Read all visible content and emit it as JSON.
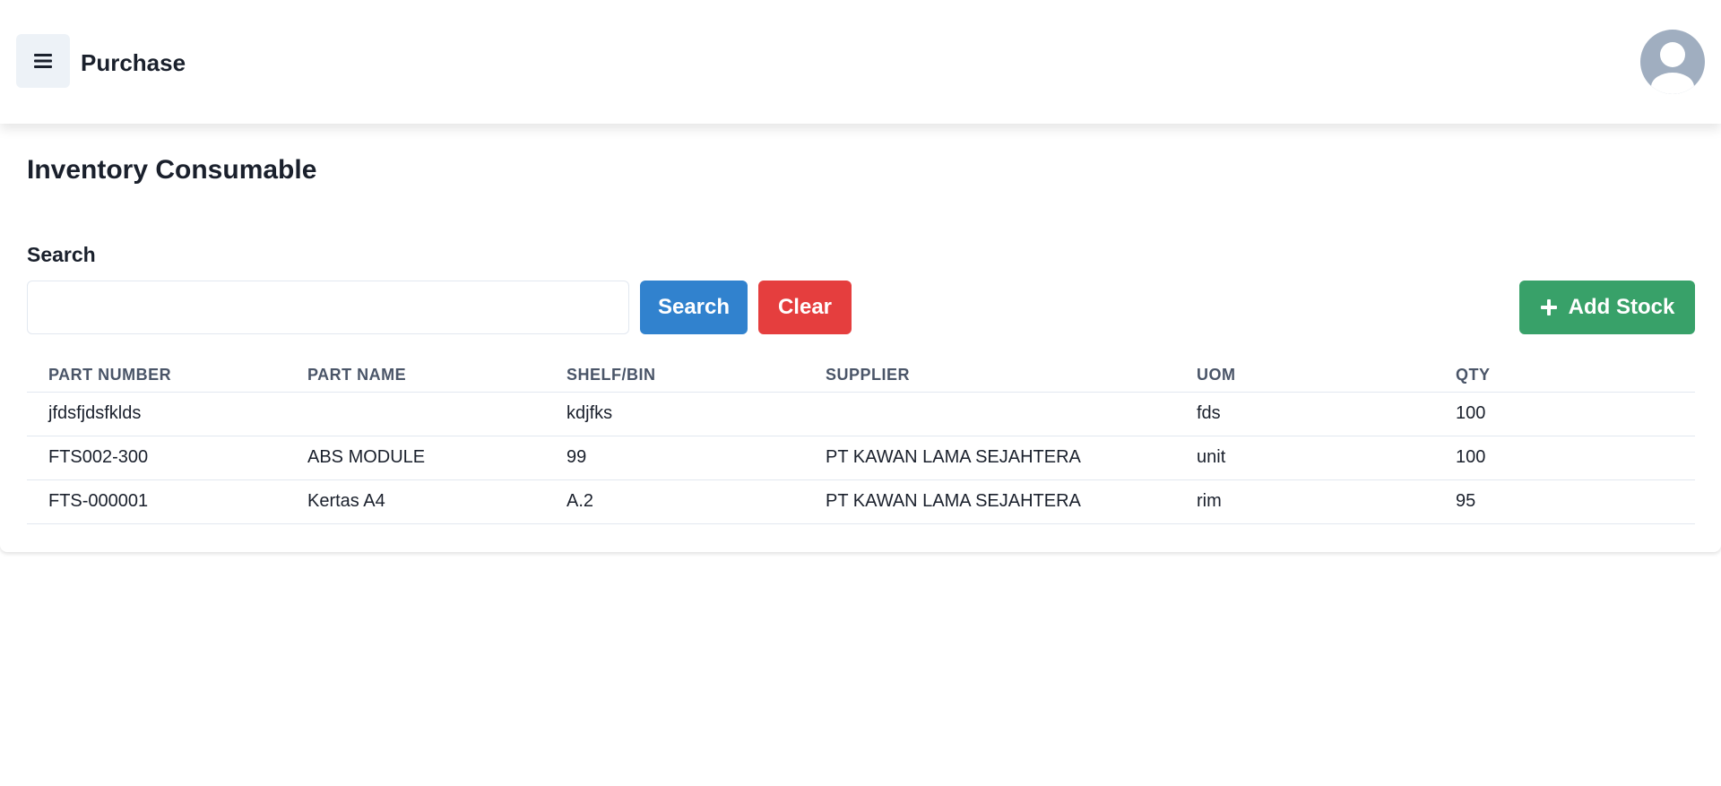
{
  "header": {
    "menu_icon": "hamburger-icon",
    "app_title": "Purchase",
    "avatar_icon": "user-avatar-icon"
  },
  "page": {
    "title": "Inventory Consumable"
  },
  "search": {
    "label": "Search",
    "value": "",
    "placeholder": "",
    "search_button": "Search",
    "clear_button": "Clear",
    "add_button": "Add Stock",
    "add_icon": "plus-icon"
  },
  "table": {
    "columns": [
      "PART NUMBER",
      "PART NAME",
      "SHELF/BIN",
      "SUPPLIER",
      "UOM",
      "QTY"
    ],
    "rows": [
      [
        "jfdsfjdsfklds",
        "",
        "kdjfks",
        "",
        "fds",
        "100"
      ],
      [
        "FTS002-300",
        "ABS MODULE",
        "99",
        "PT KAWAN LAMA SEJAHTERA",
        "unit",
        "100"
      ],
      [
        "FTS-000001",
        "Kertas A4",
        "A.2",
        "PT KAWAN LAMA SEJAHTERA",
        "rim",
        "95"
      ]
    ]
  },
  "colors": {
    "search_button": "#3182ce",
    "clear_button": "#e53e3e",
    "add_button": "#38a169",
    "avatar": "#a0aec0"
  }
}
